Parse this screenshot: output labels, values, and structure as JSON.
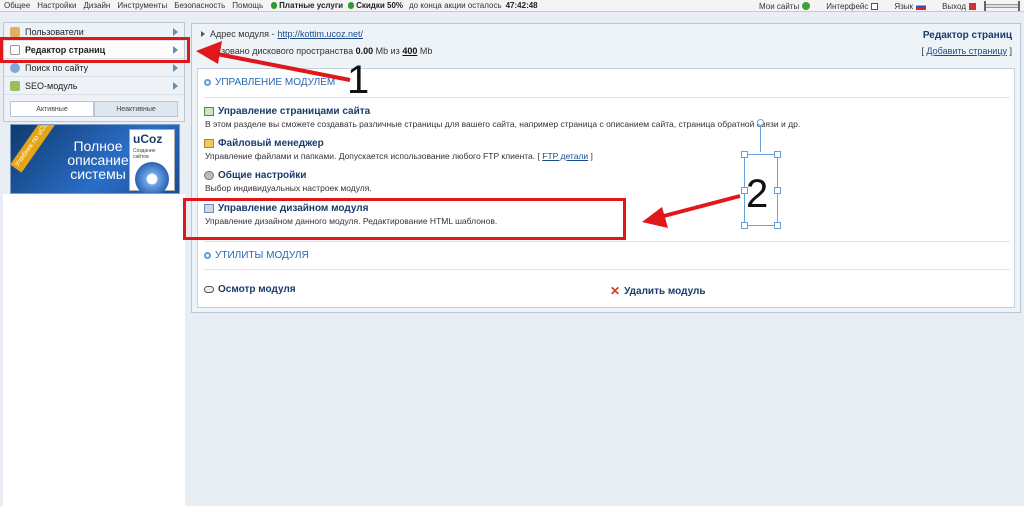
{
  "topbar": {
    "menu": [
      "Общее",
      "Настройки",
      "Дизайн",
      "Инструменты",
      "Безопасность",
      "Помощь"
    ],
    "paid_services": "Платные услуги",
    "discount": "Скидки 50%",
    "countdown_label": "до конца акции осталось",
    "countdown": "47:42:48",
    "my_sites": "Мои сайты",
    "interface": "Интерфейс",
    "language": "Язык",
    "exit": "Выход"
  },
  "sidebar": {
    "items": [
      {
        "label": "Пользователи",
        "icon": "user-icon"
      },
      {
        "label": "Редактор страниц",
        "icon": "page-icon"
      },
      {
        "label": "Поиск по сайту",
        "icon": "search-icon"
      },
      {
        "label": "SEO-модуль",
        "icon": "seo-icon"
      }
    ],
    "tabs": [
      "Активные",
      "Неактивные"
    ],
    "banner": {
      "ribbon": "Учебник по uCoz",
      "headline": "Полное описание системы",
      "book_title": "uCoz",
      "book_subtitle": "Создание сайтов"
    }
  },
  "module": {
    "address_label": "Адрес модуля -",
    "address_url": "http://kottim.ucoz.net/",
    "space_text_1": "…зовано дискового пространства",
    "space_used": "0.00",
    "space_unit_1": "Mb из",
    "space_total": "400",
    "space_unit_2": "Mb",
    "title": "Редактор страниц",
    "add_page_link": "Добавить страницу"
  },
  "sections": {
    "management_title": "УПРАВЛЕНИЕ МОДУЛЕМ",
    "items": [
      {
        "title": "Управление страницами сайта",
        "desc": "В этом разделе вы сможете создавать различные страницы для вашего сайта, например страница с описанием сайта, страница обратной связи и др.",
        "icon": "pages-icon"
      },
      {
        "title": "Файловый менеджер",
        "desc": "Управление файлами и папками. Допускается использование любого FTP клиента.",
        "link": "FTP детали",
        "icon": "folder-icon"
      },
      {
        "title": "Общие настройки",
        "desc": "Выбор индивидуальных настроек модуля.",
        "icon": "gear-icon"
      },
      {
        "title": "Управление дизайном модуля",
        "desc": "Управление дизайном данного модуля. Редактирование HTML шаблонов.",
        "icon": "design-icon"
      }
    ],
    "utilities_title": "УТИЛИТЫ МОДУЛЯ",
    "inspect": "Осмотр модуля",
    "delete": "Удалить модуль"
  },
  "annotations": {
    "marker_1": "1",
    "marker_2": "2",
    "color": "#e0171b"
  }
}
